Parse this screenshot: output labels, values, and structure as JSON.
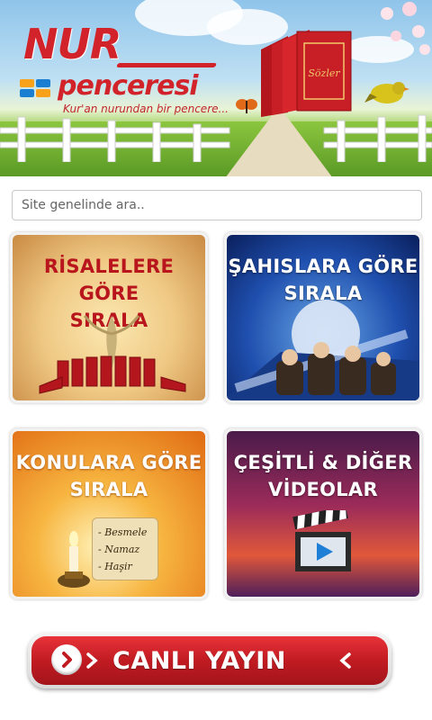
{
  "header": {
    "logo_nur": "NUR",
    "logo_penceresi": "penceresi",
    "tagline": "Kur'an nurundan bir pencere...",
    "book_label": "Sözler",
    "colors": {
      "brand_red": "#d2232a",
      "sky": "#8fc4ea",
      "grass": "#6fae33"
    }
  },
  "search": {
    "placeholder": "Site genelinde ara.."
  },
  "tiles": [
    {
      "line1": "RİSALELERE GÖRE",
      "line2": "SIRALA",
      "color": "#b8151d",
      "icon": "books-icon"
    },
    {
      "line1": "ŞAHISLARA GÖRE",
      "line2": "SIRALA",
      "color": "#ffffff",
      "icon": "people-icon"
    },
    {
      "line1": "KONULARA GÖRE",
      "line2": "SIRALA",
      "color": "#ffffff",
      "icon": "scroll-icon",
      "scroll_items": [
        "- Besmele",
        "- Namaz",
        "- Haşir"
      ]
    },
    {
      "line1": "ÇEŞİTLİ & DİĞER",
      "line2": "VİDEOLAR",
      "color": "#ffffff",
      "icon": "clapperboard-icon"
    }
  ],
  "live_button": {
    "label": "CANLI YAYIN",
    "color": "#c11b22",
    "icon": "play-circle-icon"
  }
}
